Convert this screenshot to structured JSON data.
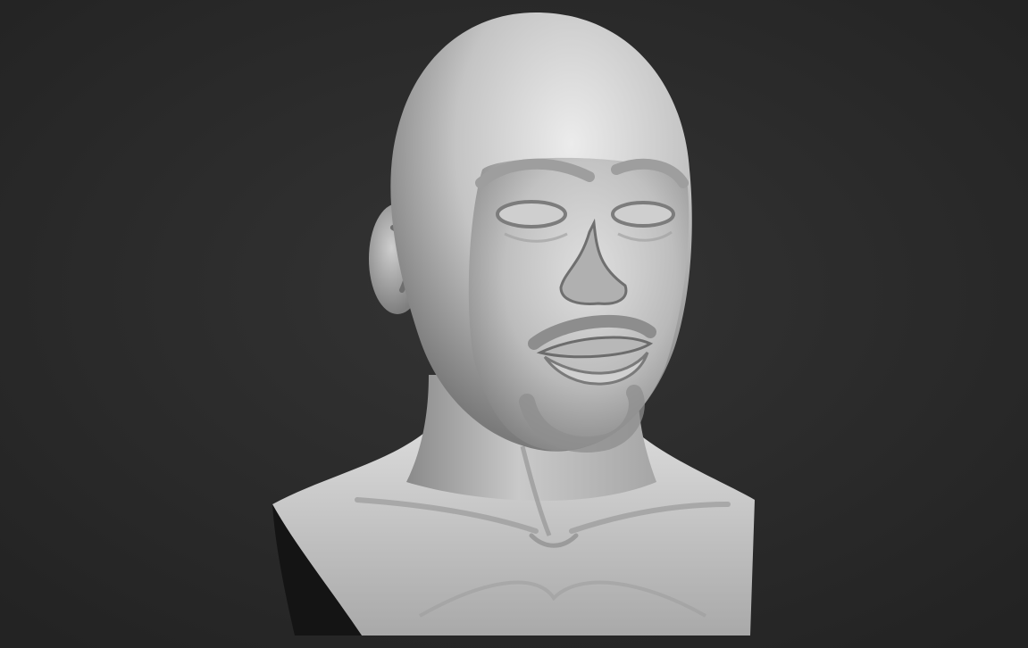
{
  "scene": {
    "subject": "sculpted-bust-render",
    "colors": {
      "background_center": "#333333",
      "background_edge": "#232323",
      "clay_light": "#e6e6e6",
      "clay_mid": "#b5b5b5",
      "clay_dark": "#6a6a6a",
      "shadow": "#141414"
    }
  }
}
